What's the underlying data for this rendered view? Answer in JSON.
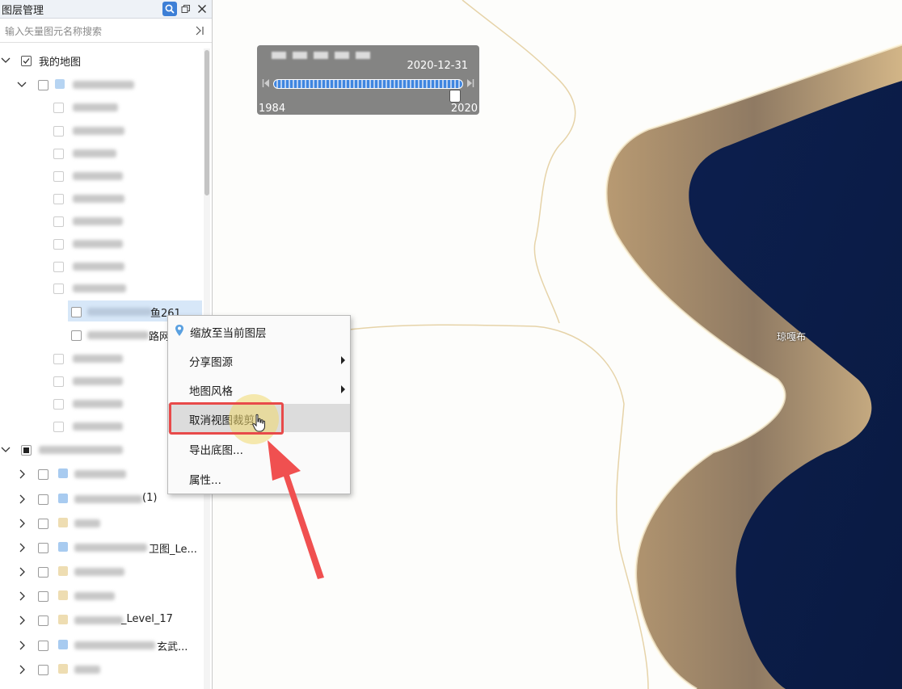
{
  "panel": {
    "title": "图层管理",
    "search_placeholder": "输入矢量图元名称搜索"
  },
  "tree": {
    "root_label": "我的地图",
    "highlighted_suffix": "鱼261",
    "sub_suffix": "路网",
    "rows_bottom_suffixes": [
      "(1)",
      "卫图_Le...",
      "_Level_17",
      "玄武..."
    ]
  },
  "timeline": {
    "current_date": "2020-12-31",
    "start_year": "1984",
    "end_year": "2020",
    "progress": 1.0
  },
  "map": {
    "place_label": "琼嘎布"
  },
  "context_menu": {
    "items": [
      {
        "label": "缩放至当前图层"
      },
      {
        "label": "分享图源"
      },
      {
        "label": "地图风格"
      },
      {
        "label": "取消视图裁剪"
      },
      {
        "label": "导出底图..."
      },
      {
        "label": "属性..."
      }
    ]
  },
  "colors": {
    "accent": "#3d7fd6",
    "highlight_border": "#e84a4a",
    "selection": "#d7e7f8"
  }
}
